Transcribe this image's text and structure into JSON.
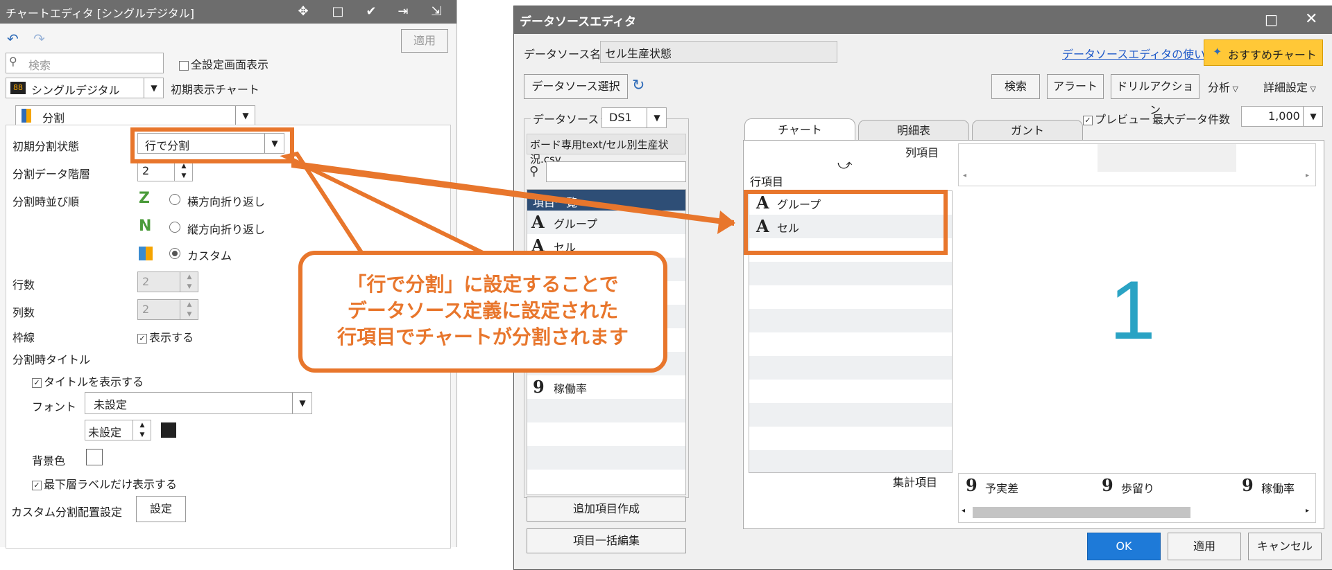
{
  "chart_editor": {
    "title": "チャートエディタ [シングルデジタル]",
    "apply_label": "適用",
    "search_placeholder": "検索",
    "show_all_settings_label": "全設定画面表示",
    "chart_type_value": "シングルデジタル",
    "chart_type_badge": "88",
    "initial_chart_label": "初期表示チャート",
    "section_value": "分割",
    "initial_split_label": "初期分割状態",
    "initial_split_value": "行で分割",
    "split_level_label": "分割データ階層",
    "split_level_value": "2",
    "split_order_label": "分割時並び順",
    "order_options": [
      "横方向折り返し",
      "縦方向折り返し",
      "カスタム"
    ],
    "order_selected": "カスタム",
    "rows_label": "行数",
    "rows_value": "2",
    "cols_label": "列数",
    "cols_value": "2",
    "border_label": "枠線",
    "border_check_label": "表示する",
    "split_title_label": "分割時タイトル",
    "show_title_label": "タイトルを表示する",
    "font_label": "フォント",
    "font_value": "未設定",
    "font_size_value": "未設定",
    "bg_label": "背景色",
    "bottom_label_only": "最下層ラベルだけ表示する",
    "custom_layout_label": "カスタム分割配置設定",
    "custom_layout_button": "設定"
  },
  "ds_editor": {
    "title": "データソースエディタ",
    "ds_name_label": "データソース名",
    "ds_name_value": "セル生産状態",
    "help_link": "データソースエディタの使い方",
    "recommend_button": "おすすめチャート",
    "select_ds_button": "データソース選択",
    "search_button": "検索",
    "alert_button": "アラート",
    "drill_button": "ドリルアクション",
    "analysis_menu": "分析",
    "detail_menu": "詳細設定",
    "ds_label": "データソース",
    "ds_value": "DS1",
    "file_path": "ボード専用text/セル別生産状況.csv",
    "item_list_header": "項目一覧",
    "items": [
      {
        "icon": "A",
        "label": "グループ"
      },
      {
        "icon": "A",
        "label": "セル"
      },
      {
        "icon": "9",
        "label": "稼働率"
      }
    ],
    "add_item_button": "追加項目作成",
    "bulk_edit_button": "項目一括編集",
    "tabs": [
      "チャート",
      "明細表",
      "ガント"
    ],
    "preview_label": "プレビュー",
    "max_rows_label": "最大データ件数",
    "max_rows_value": "1,000",
    "col_items_label": "列項目",
    "row_items_label": "行項目",
    "row_items": [
      "グループ",
      "セル"
    ],
    "preview_value": "1",
    "agg_label": "集計項目",
    "agg_items": [
      "予実差",
      "歩留り",
      "稼働率"
    ],
    "ok_button": "OK",
    "apply_button": "適用",
    "cancel_button": "キャンセル"
  },
  "callout": {
    "line1": "「行で分割」に設定することで",
    "line2": "データソース定義に設定された",
    "line3": "行項目でチャートが分割されます"
  },
  "colors": {
    "accent_orange": "#e8762c",
    "ok_blue": "#1e7ad8",
    "preview_digit": "#2aa3c4",
    "titlebar": "#6d6d6d"
  }
}
